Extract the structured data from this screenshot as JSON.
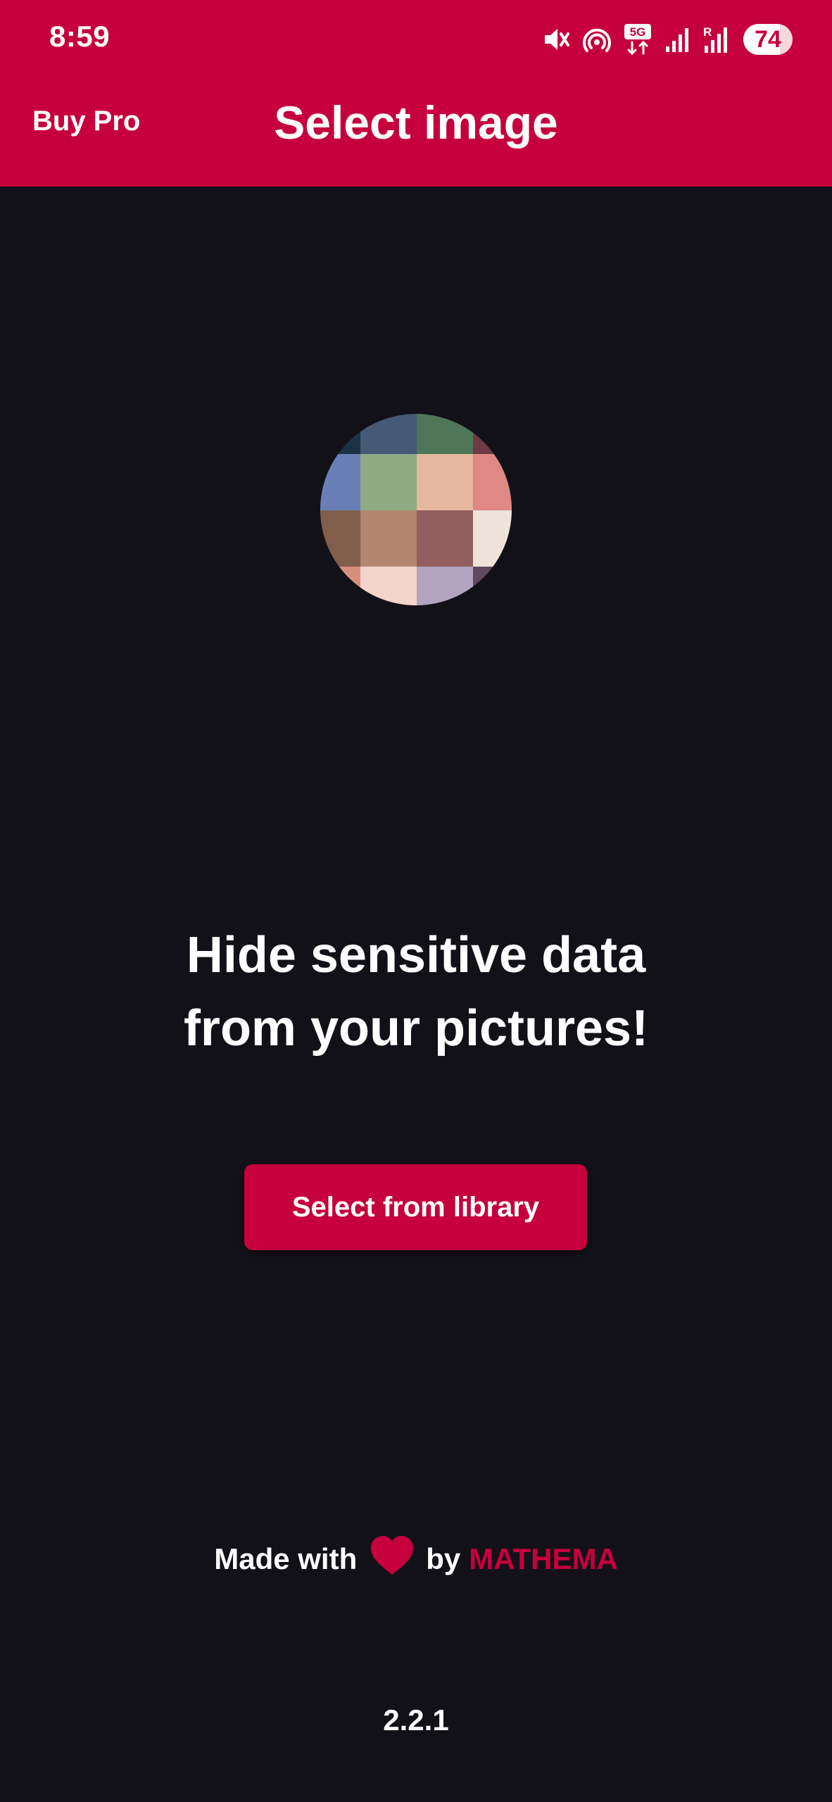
{
  "status_bar": {
    "time": "8:59",
    "icons": [
      "mute-icon",
      "hotspot-icon",
      "5g-icon",
      "signal-icon",
      "signal-roaming-icon"
    ],
    "network_badge": "5G",
    "roaming_badge": "R",
    "battery": "74",
    "battery_level": 0.74
  },
  "header": {
    "buy_pro_label": "Buy Pro",
    "title": "Select image"
  },
  "main": {
    "tagline_line1": "Hide sensitive data",
    "tagline_line2": "from your pictures!",
    "select_button_label": "Select from library"
  },
  "footer": {
    "made_with": "Made with",
    "by": "by",
    "brand": "MATHEMA",
    "version": "2.2.1"
  },
  "colors": {
    "accent": "#c6003c",
    "background": "#131118",
    "text": "#ffffff"
  }
}
